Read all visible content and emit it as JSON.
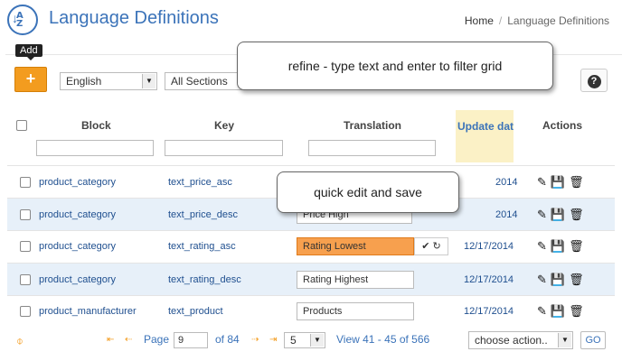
{
  "header": {
    "title": "Language Definitions",
    "breadcrumb": {
      "home": "Home",
      "current": "Language Definitions"
    }
  },
  "toolbar": {
    "add_tooltip": "Add",
    "add_symbol": "+",
    "language_value": "English",
    "section_value": "All Sections",
    "help_symbol": "?"
  },
  "columns": {
    "block": "Block",
    "key": "Key",
    "translation": "Translation",
    "update_date": "Update dat",
    "actions": "Actions"
  },
  "rows": [
    {
      "block": "product_category",
      "key": "text_price_asc",
      "translation": "",
      "date": "2014"
    },
    {
      "block": "product_category",
      "key": "text_price_desc",
      "translation": "Price High",
      "date": "2014"
    },
    {
      "block": "product_category",
      "key": "text_rating_asc",
      "translation": "Rating Lowest",
      "date": "12/17/2014"
    },
    {
      "block": "product_category",
      "key": "text_rating_desc",
      "translation": "Rating Highest",
      "date": "12/17/2014"
    },
    {
      "block": "product_manufacturer",
      "key": "text_product",
      "translation": "Products",
      "date": "12/17/2014"
    }
  ],
  "row_actions": {
    "edit_icon": "✎",
    "save_icon": "💾",
    "delete_icon": "🗑"
  },
  "quick_edit": {
    "confirm_icon": "✔",
    "refresh_icon": "↻"
  },
  "pagination": {
    "first": "⇤",
    "prev": "⇠",
    "page_label": "Page",
    "page_value": "9",
    "of_pages": "of 84",
    "next": "⇢",
    "last": "⇥",
    "per_page": "5",
    "view_text": "View 41 - 45 of 566",
    "bulk_action": "choose action..",
    "go_label": "GO",
    "refresh_symbol": "⌽"
  },
  "callouts": {
    "refine": "refine - type text and enter to filter grid",
    "quick_edit": "quick edit and save"
  },
  "colors": {
    "accent": "#3b73b9",
    "add": "#f39c1f",
    "active_edit": "#f7a04e",
    "alt_row": "#e7f0f9",
    "date_col": "#fbf1c6"
  }
}
